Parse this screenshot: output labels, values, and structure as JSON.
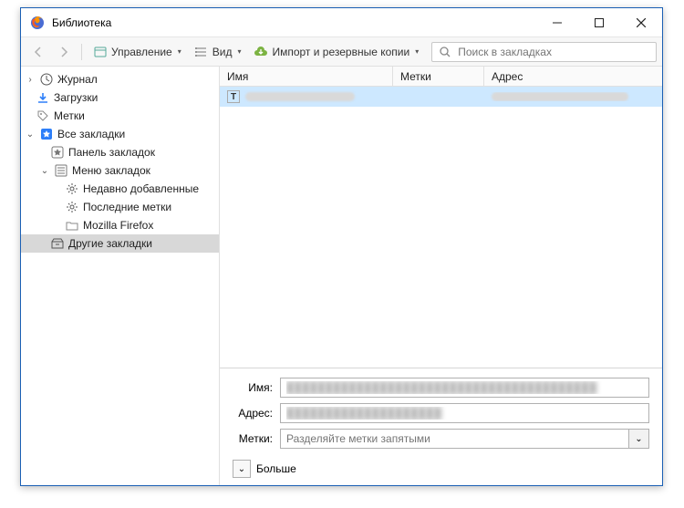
{
  "window": {
    "title": "Библиотека"
  },
  "toolbar": {
    "manage_label": "Управление",
    "view_label": "Вид",
    "import_label": "Импорт и резервные копии",
    "search_placeholder": "Поиск в закладках"
  },
  "tree": {
    "journal": "Журнал",
    "downloads": "Загрузки",
    "tags": "Метки",
    "all_bookmarks": "Все закладки",
    "toolbar_panel": "Панель закладок",
    "bookmarks_menu": "Меню закладок",
    "recently_added": "Недавно добавленные",
    "recent_tags": "Последние метки",
    "mozilla_firefox": "Mozilla Firefox",
    "other_bookmarks": "Другие закладки"
  },
  "columns": {
    "name": "Имя",
    "tags": "Метки",
    "address": "Адрес"
  },
  "item": {
    "name_redacted": "████████████████",
    "address_redacted": "██████████████████"
  },
  "details": {
    "name_label": "Имя:",
    "address_label": "Адрес:",
    "tags_label": "Метки:",
    "tags_placeholder": "Разделяйте метки запятыми",
    "more_label": "Больше"
  },
  "icons": {
    "t_glyph": "T"
  },
  "colors": {
    "selection": "#cde8ff",
    "tree_selection": "#d8d8d8",
    "accent": "#0a84ff"
  }
}
